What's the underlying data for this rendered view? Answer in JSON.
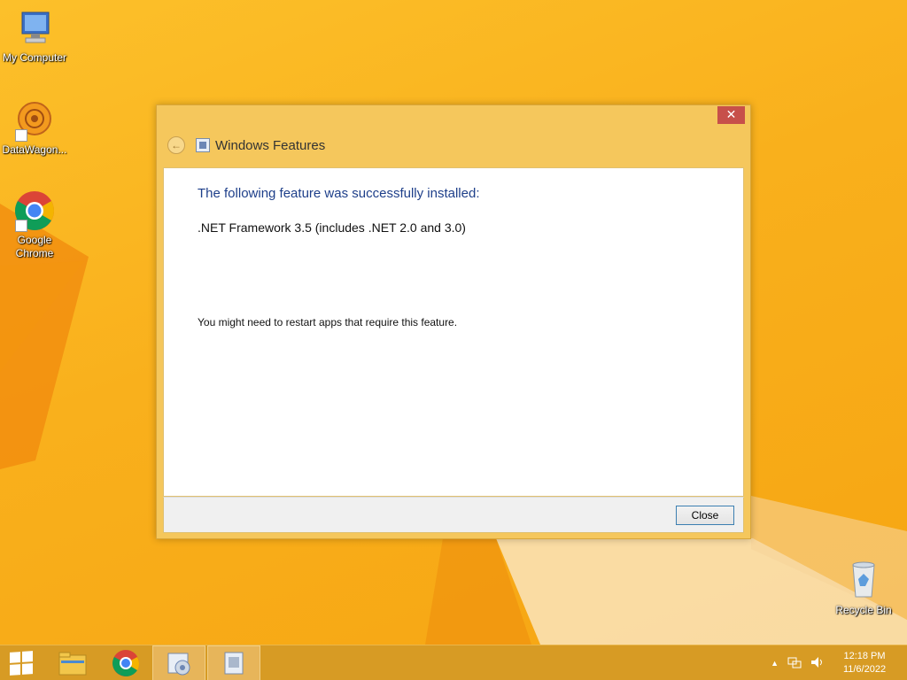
{
  "desktop": {
    "icons": [
      {
        "label": "My Computer",
        "icon": "computer-icon"
      },
      {
        "label": "DataWagon...",
        "icon": "datawagon-icon"
      },
      {
        "label": "Google Chrome",
        "icon": "chrome-icon"
      },
      {
        "label": "Recycle Bin",
        "icon": "recycle-bin-icon"
      }
    ]
  },
  "window": {
    "title": "Windows Features",
    "close_glyph": "✕",
    "back_glyph": "←",
    "heading": "The following feature was successfully installed:",
    "feature": ".NET Framework 3.5 (includes .NET 2.0 and 3.0)",
    "note": "You might need to restart apps that require this feature.",
    "close_button": "Close"
  },
  "taskbar": {
    "items": [
      "start-icon",
      "file-explorer-icon",
      "chrome-icon",
      "optional-features-icon",
      "windows-features-icon"
    ],
    "tray_arrow": "▲",
    "time": "12:18 PM",
    "date": "11/6/2022"
  },
  "colors": {
    "accent_heading": "#1e3f8a",
    "desktop_bg": "#f7ad1a",
    "taskbar_bg": "#d79b24",
    "close_red": "#c7504a"
  }
}
